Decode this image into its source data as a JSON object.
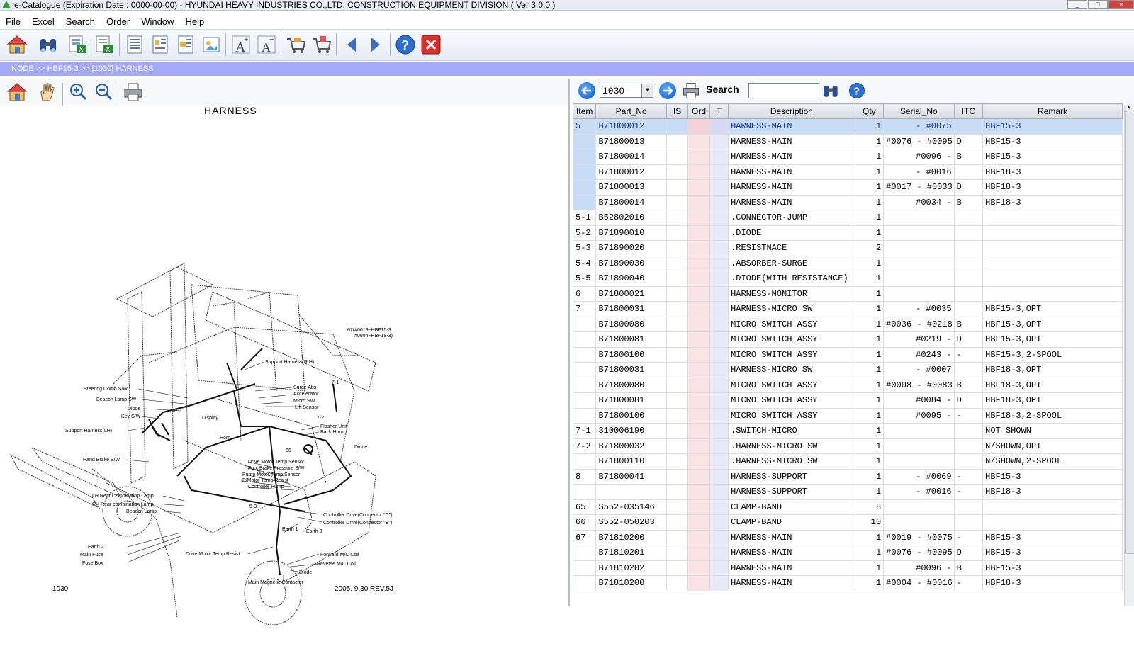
{
  "window": {
    "title": "e-Catalogue (Expiration Date : 0000-00-00)  -  HYUNDAI HEAVY INDUSTRIES CO.,LTD. CONSTRUCTION EQUIPMENT DIVISION ( Ver 3.0.0 )"
  },
  "menu": [
    "File",
    "Excel",
    "Search",
    "Order",
    "Window",
    "Help"
  ],
  "toolbar": {
    "icons": [
      "home-icon",
      "binoculars-icon",
      "excel-export-icon",
      "excel-export2-icon",
      "list-icon",
      "image-list-icon",
      "image-list2-icon",
      "image-icon",
      "font-larger-icon",
      "font-smaller-icon",
      "cart-icon",
      "cart-add-icon",
      "back-arrow-icon",
      "forward-arrow-icon",
      "help-icon",
      "close-icon"
    ]
  },
  "breadcrumb": "NODE >> HBF15-3 >> [1030] HARNESS",
  "left": {
    "icons": [
      "home-icon",
      "hand-pan-icon",
      "zoom-in-icon",
      "zoom-out-icon",
      "print-icon"
    ],
    "drawing_title": "HARNESS",
    "page_number": "1030",
    "revision": "2005. 9.30 REV.5J",
    "labels": {
      "l1": "Steering Comb.S/W",
      "l2": "Beacon Lamp SW",
      "l3": "Diode",
      "l4": "Key S/W",
      "l5": "Support Harness(LH)",
      "l6": "Hand Brake S/W",
      "l7": "LH Rear Combination Lamp",
      "l8": "RH Rear combination Lamp",
      "l9": "Beacon Lamp",
      "l10": "Earth 2",
      "l11": "Main Fuse",
      "l12": "Fuse Box",
      "l13": "Support Harness(R.H)",
      "l14": "Surge Abs",
      "l15": "Accelerator",
      "l16": "Micro SW",
      "l17": "Lift Sensor",
      "l18": "Flasher Unit",
      "l19": "Back Horn",
      "l20": "Drive Motor Temp Sensor",
      "l21": "Foot Brake Pressure S/W",
      "l22": "Pump Motor Temp Sensor",
      "l23": "P/Motor Temp Resist",
      "l24": "Controller Pump",
      "l25": "Controller Drive(Connector \"C\")",
      "l26": "Controller Drive(Connector \"B\")",
      "l27": "Earth 1",
      "l28": "Earth 3",
      "l29": "Drive Motor Temp Resist",
      "l30": "Forward M/C Coil",
      "l31": "Reverse M/C Coil",
      "l32": "Diode",
      "l33": "Main Magnetic Contactor",
      "l34": "67(#0019~HBF15-3",
      "l35": "#0004~HBF18-3)",
      "l36": "7-1",
      "l37": "7-2",
      "l38": "66",
      "l39": "5-3",
      "l40": "Horn",
      "l41": "Display",
      "l42": "Diode"
    }
  },
  "right": {
    "combo_value": "1030",
    "search_label": "Search",
    "search_value": "",
    "columns": [
      "Item",
      "Part_No",
      "IS",
      "Ord",
      "T",
      "Description",
      "Qty",
      "Serial_No",
      "ITC",
      "Remark"
    ],
    "rows": [
      {
        "item": "5",
        "part": "B71800012",
        "desc": "HARNESS-MAIN",
        "qty": "1",
        "serial": "- #0075",
        "itc": "",
        "remark": "HBF15-3"
      },
      {
        "item": "",
        "part": "B71800013",
        "desc": "HARNESS-MAIN",
        "qty": "1",
        "serial": "#0076 - #0095",
        "itc": "D",
        "remark": "HBF15-3"
      },
      {
        "item": "",
        "part": "B71800014",
        "desc": "HARNESS-MAIN",
        "qty": "1",
        "serial": "#0096 -      ",
        "itc": "B",
        "remark": "HBF15-3"
      },
      {
        "item": "",
        "part": "B71800012",
        "desc": "HARNESS-MAIN",
        "qty": "1",
        "serial": "- #0016",
        "itc": "",
        "remark": "HBF18-3"
      },
      {
        "item": "",
        "part": "B71800013",
        "desc": "HARNESS-MAIN",
        "qty": "1",
        "serial": "#0017 - #0033",
        "itc": "D",
        "remark": "HBF18-3"
      },
      {
        "item": "",
        "part": "B71800014",
        "desc": "HARNESS-MAIN",
        "qty": "1",
        "serial": "#0034 -      ",
        "itc": "B",
        "remark": "HBF18-3"
      },
      {
        "item": "5-1",
        "part": "B52802010",
        "desc": ".CONNECTOR-JUMP",
        "qty": "1",
        "serial": "",
        "itc": "",
        "remark": ""
      },
      {
        "item": "5-2",
        "part": "B71890010",
        "desc": ".DIODE",
        "qty": "1",
        "serial": "",
        "itc": "",
        "remark": ""
      },
      {
        "item": "5-3",
        "part": "B71890020",
        "desc": ".RESISTNACE",
        "qty": "2",
        "serial": "",
        "itc": "",
        "remark": ""
      },
      {
        "item": "5-4",
        "part": "B71890030",
        "desc": ".ABSORBER-SURGE",
        "qty": "1",
        "serial": "",
        "itc": "",
        "remark": ""
      },
      {
        "item": "5-5",
        "part": "B71890040",
        "desc": ".DIODE(WITH RESISTANCE)",
        "qty": "1",
        "serial": "",
        "itc": "",
        "remark": ""
      },
      {
        "item": "6",
        "part": "B71800021",
        "desc": "HARNESS-MONITOR",
        "qty": "1",
        "serial": "",
        "itc": "",
        "remark": ""
      },
      {
        "item": "7",
        "part": "B71800031",
        "desc": "HARNESS-MICRO SW",
        "qty": "1",
        "serial": "- #0035",
        "itc": "",
        "remark": "HBF15-3,OPT"
      },
      {
        "item": "",
        "part": "B71800080",
        "desc": "MICRO SWITCH ASSY",
        "qty": "1",
        "serial": "#0036 - #0218",
        "itc": "B",
        "remark": "HBF15-3,OPT"
      },
      {
        "item": "",
        "part": "B71800081",
        "desc": "MICRO SWITCH ASSY",
        "qty": "1",
        "serial": "#0219 -      ",
        "itc": "D",
        "remark": "HBF15-3,OPT"
      },
      {
        "item": "",
        "part": "B71800100",
        "desc": "MICRO SWITCH ASSY",
        "qty": "1",
        "serial": "#0243 -      ",
        "itc": "-",
        "remark": "HBF15-3,2-SPOOL"
      },
      {
        "item": "",
        "part": "B71800031",
        "desc": "HARNESS-MICRO SW",
        "qty": "1",
        "serial": "- #0007",
        "itc": "",
        "remark": "HBF18-3,OPT"
      },
      {
        "item": "",
        "part": "B71800080",
        "desc": "MICRO SWITCH ASSY",
        "qty": "1",
        "serial": "#0008 - #0083",
        "itc": "B",
        "remark": "HBF18-3,OPT"
      },
      {
        "item": "",
        "part": "B71800081",
        "desc": "MICRO SWITCH ASSY",
        "qty": "1",
        "serial": "#0084 -      ",
        "itc": "D",
        "remark": "HBF18-3,OPT"
      },
      {
        "item": "",
        "part": "B71800100",
        "desc": "MICRO SWITCH ASSY",
        "qty": "1",
        "serial": "#0095 -      ",
        "itc": "-",
        "remark": "HBF18-3,2-SPOOL"
      },
      {
        "item": "7-1",
        "part": "310006190",
        "desc": ".SWITCH-MICRO",
        "qty": "1",
        "serial": "",
        "itc": "",
        "remark": "NOT SHOWN"
      },
      {
        "item": "7-2",
        "part": "B71800032",
        "desc": ".HARNESS-MICRO SW",
        "qty": "1",
        "serial": "",
        "itc": "",
        "remark": "N/SHOWN,OPT"
      },
      {
        "item": "",
        "part": "B71800110",
        "desc": ".HARNESS-MICRO SW",
        "qty": "1",
        "serial": "",
        "itc": "",
        "remark": "N/SHOWN,2-SPOOL"
      },
      {
        "item": "8",
        "part": "B71800041",
        "desc": "HARNESS-SUPPORT",
        "qty": "1",
        "serial": "- #0069",
        "itc": "-",
        "remark": "HBF15-3"
      },
      {
        "item": "",
        "part": "",
        "desc": "HARNESS-SUPPORT",
        "qty": "1",
        "serial": "- #0016",
        "itc": "-",
        "remark": "HBF18-3"
      },
      {
        "item": "65",
        "part": "S552-035146",
        "desc": "CLAMP-BAND",
        "qty": "8",
        "serial": "",
        "itc": "",
        "remark": ""
      },
      {
        "item": "66",
        "part": "S552-050203",
        "desc": "CLAMP-BAND",
        "qty": "10",
        "serial": "",
        "itc": "",
        "remark": ""
      },
      {
        "item": "67",
        "part": "B71810200",
        "desc": "HARNESS-MAIN",
        "qty": "1",
        "serial": "#0019 - #0075",
        "itc": "-",
        "remark": "HBF15-3"
      },
      {
        "item": "",
        "part": "B71810201",
        "desc": "HARNESS-MAIN",
        "qty": "1",
        "serial": "#0076 - #0095",
        "itc": "D",
        "remark": "HBF15-3"
      },
      {
        "item": "",
        "part": "B71810202",
        "desc": "HARNESS-MAIN",
        "qty": "1",
        "serial": "#0096 -      ",
        "itc": "B",
        "remark": "HBF15-3"
      },
      {
        "item": "",
        "part": "B71810200",
        "desc": "HARNESS-MAIN",
        "qty": "1",
        "serial": "#0004 - #0016",
        "itc": "-",
        "remark": "HBF18-3"
      }
    ]
  }
}
